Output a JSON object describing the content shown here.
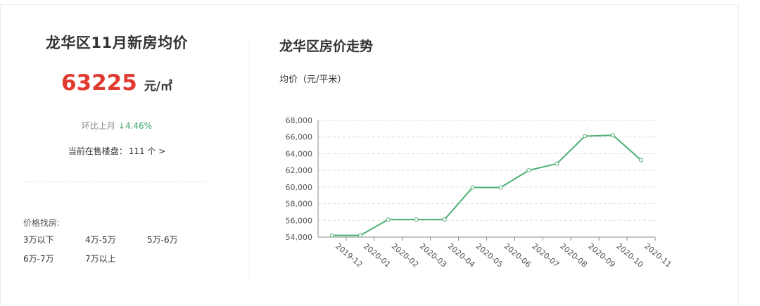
{
  "left": {
    "title": "龙华区11月新房均价",
    "price": "63225",
    "unit": "元/㎡",
    "change_label": "环比上月",
    "change_value": "↓4.46%",
    "onsale_label": "当前在售楼盘：",
    "onsale_count": "111 个 >",
    "filter_label": "价格找房:",
    "price_ranges": [
      "3万以下",
      "4万-5万",
      "5万-6万",
      "6万-7万",
      "7万以上"
    ]
  },
  "right": {
    "title": "龙华区房价走势",
    "unit_label": "均价（元/平米）"
  },
  "colors": {
    "line": "#4caf72",
    "price": "#e03a2f",
    "down": "#3aa56a",
    "grid": "#dddddd"
  },
  "chart_data": {
    "type": "line",
    "categories": [
      "2019-12",
      "2020-01",
      "2020-02",
      "2020-03",
      "2020-04",
      "2020-05",
      "2020-06",
      "2020-07",
      "2020-08",
      "2020-09",
      "2020-10",
      "2020-11"
    ],
    "series": [
      {
        "values": [
          54200,
          54200,
          56100,
          56100,
          56100,
          59950,
          59950,
          62000,
          62800,
          66100,
          66200,
          63225
        ]
      }
    ],
    "ylim": [
      54000,
      68000
    ],
    "yticks": [
      "54,000",
      "56,000",
      "58,000",
      "60,000",
      "62,000",
      "64,000",
      "66,000",
      "68,000"
    ],
    "ylabel": "均价（元/平米）",
    "grid": "horizontal dashed"
  }
}
